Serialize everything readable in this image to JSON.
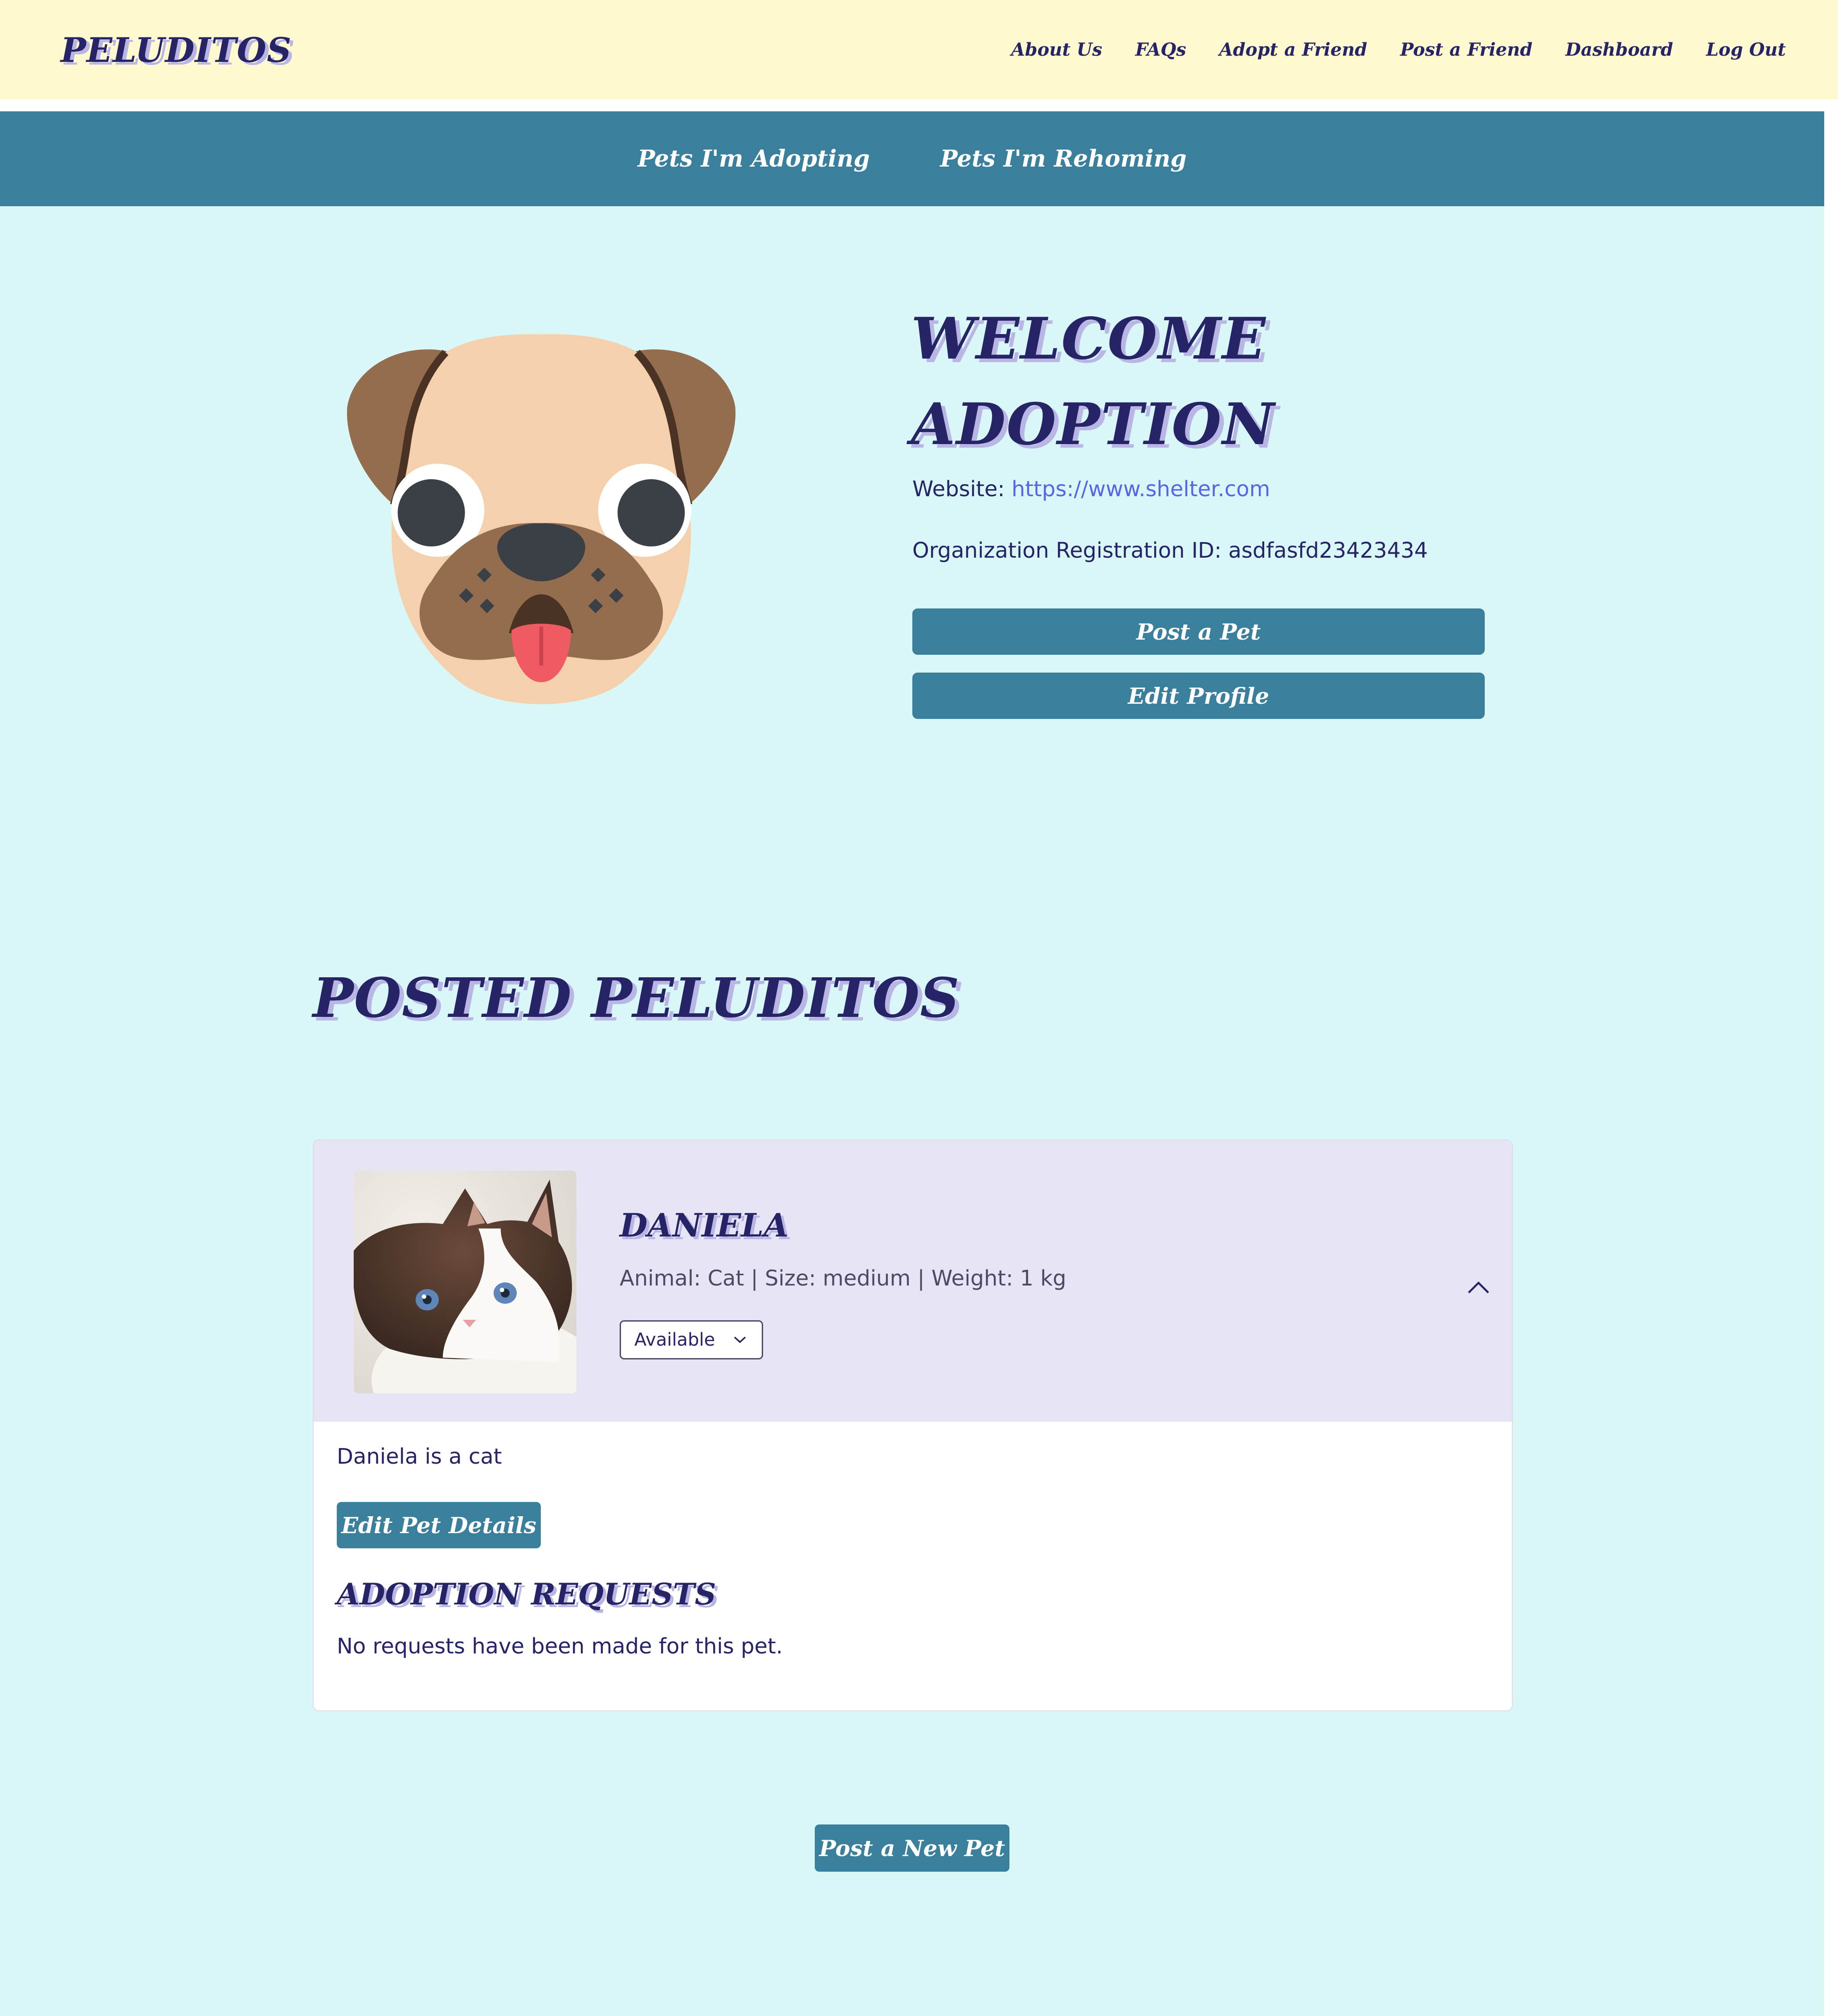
{
  "nav": {
    "brand": "PELUDITOS",
    "links": [
      "About Us",
      "FAQs",
      "Adopt a Friend",
      "Post a Friend",
      "Dashboard",
      "Log Out"
    ]
  },
  "subnav": {
    "tabs": [
      "Pets I'm Adopting",
      "Pets I'm Rehoming"
    ]
  },
  "profile": {
    "welcome_line1": "WELCOME",
    "welcome_line2": "ADOPTION",
    "website_label": "Website:",
    "website_url": "https://www.shelter.com",
    "registration_label": "Organization Registration ID:",
    "registration_id": "asdfasfd23423434",
    "avatar_icon": "pug-face-icon",
    "post_pet_label": "Post a Pet",
    "edit_profile_label": "Edit Profile"
  },
  "posted": {
    "title": "POSTED PELUDITOS",
    "pets": [
      {
        "name": "DANIELA",
        "meta": "Animal: Cat | Size: medium | Weight: 1 kg",
        "status": "Available",
        "description": "Daniela is a cat",
        "edit_label": "Edit Pet Details",
        "requests_title": "ADOPTION REQUESTS",
        "requests_empty": "No requests have been made for this pet."
      }
    ]
  },
  "footer_action": {
    "post_new_label": "Post a New Pet"
  },
  "colors": {
    "topbar_bg": "#fff9cf",
    "subnav_bg": "#3a7f9b",
    "page_bg": "#d9f7f6",
    "heading": "#262466",
    "heading_shadow": "#b9b6e6",
    "link": "#5b63e6",
    "card_header_bg": "#e6e4f5"
  }
}
